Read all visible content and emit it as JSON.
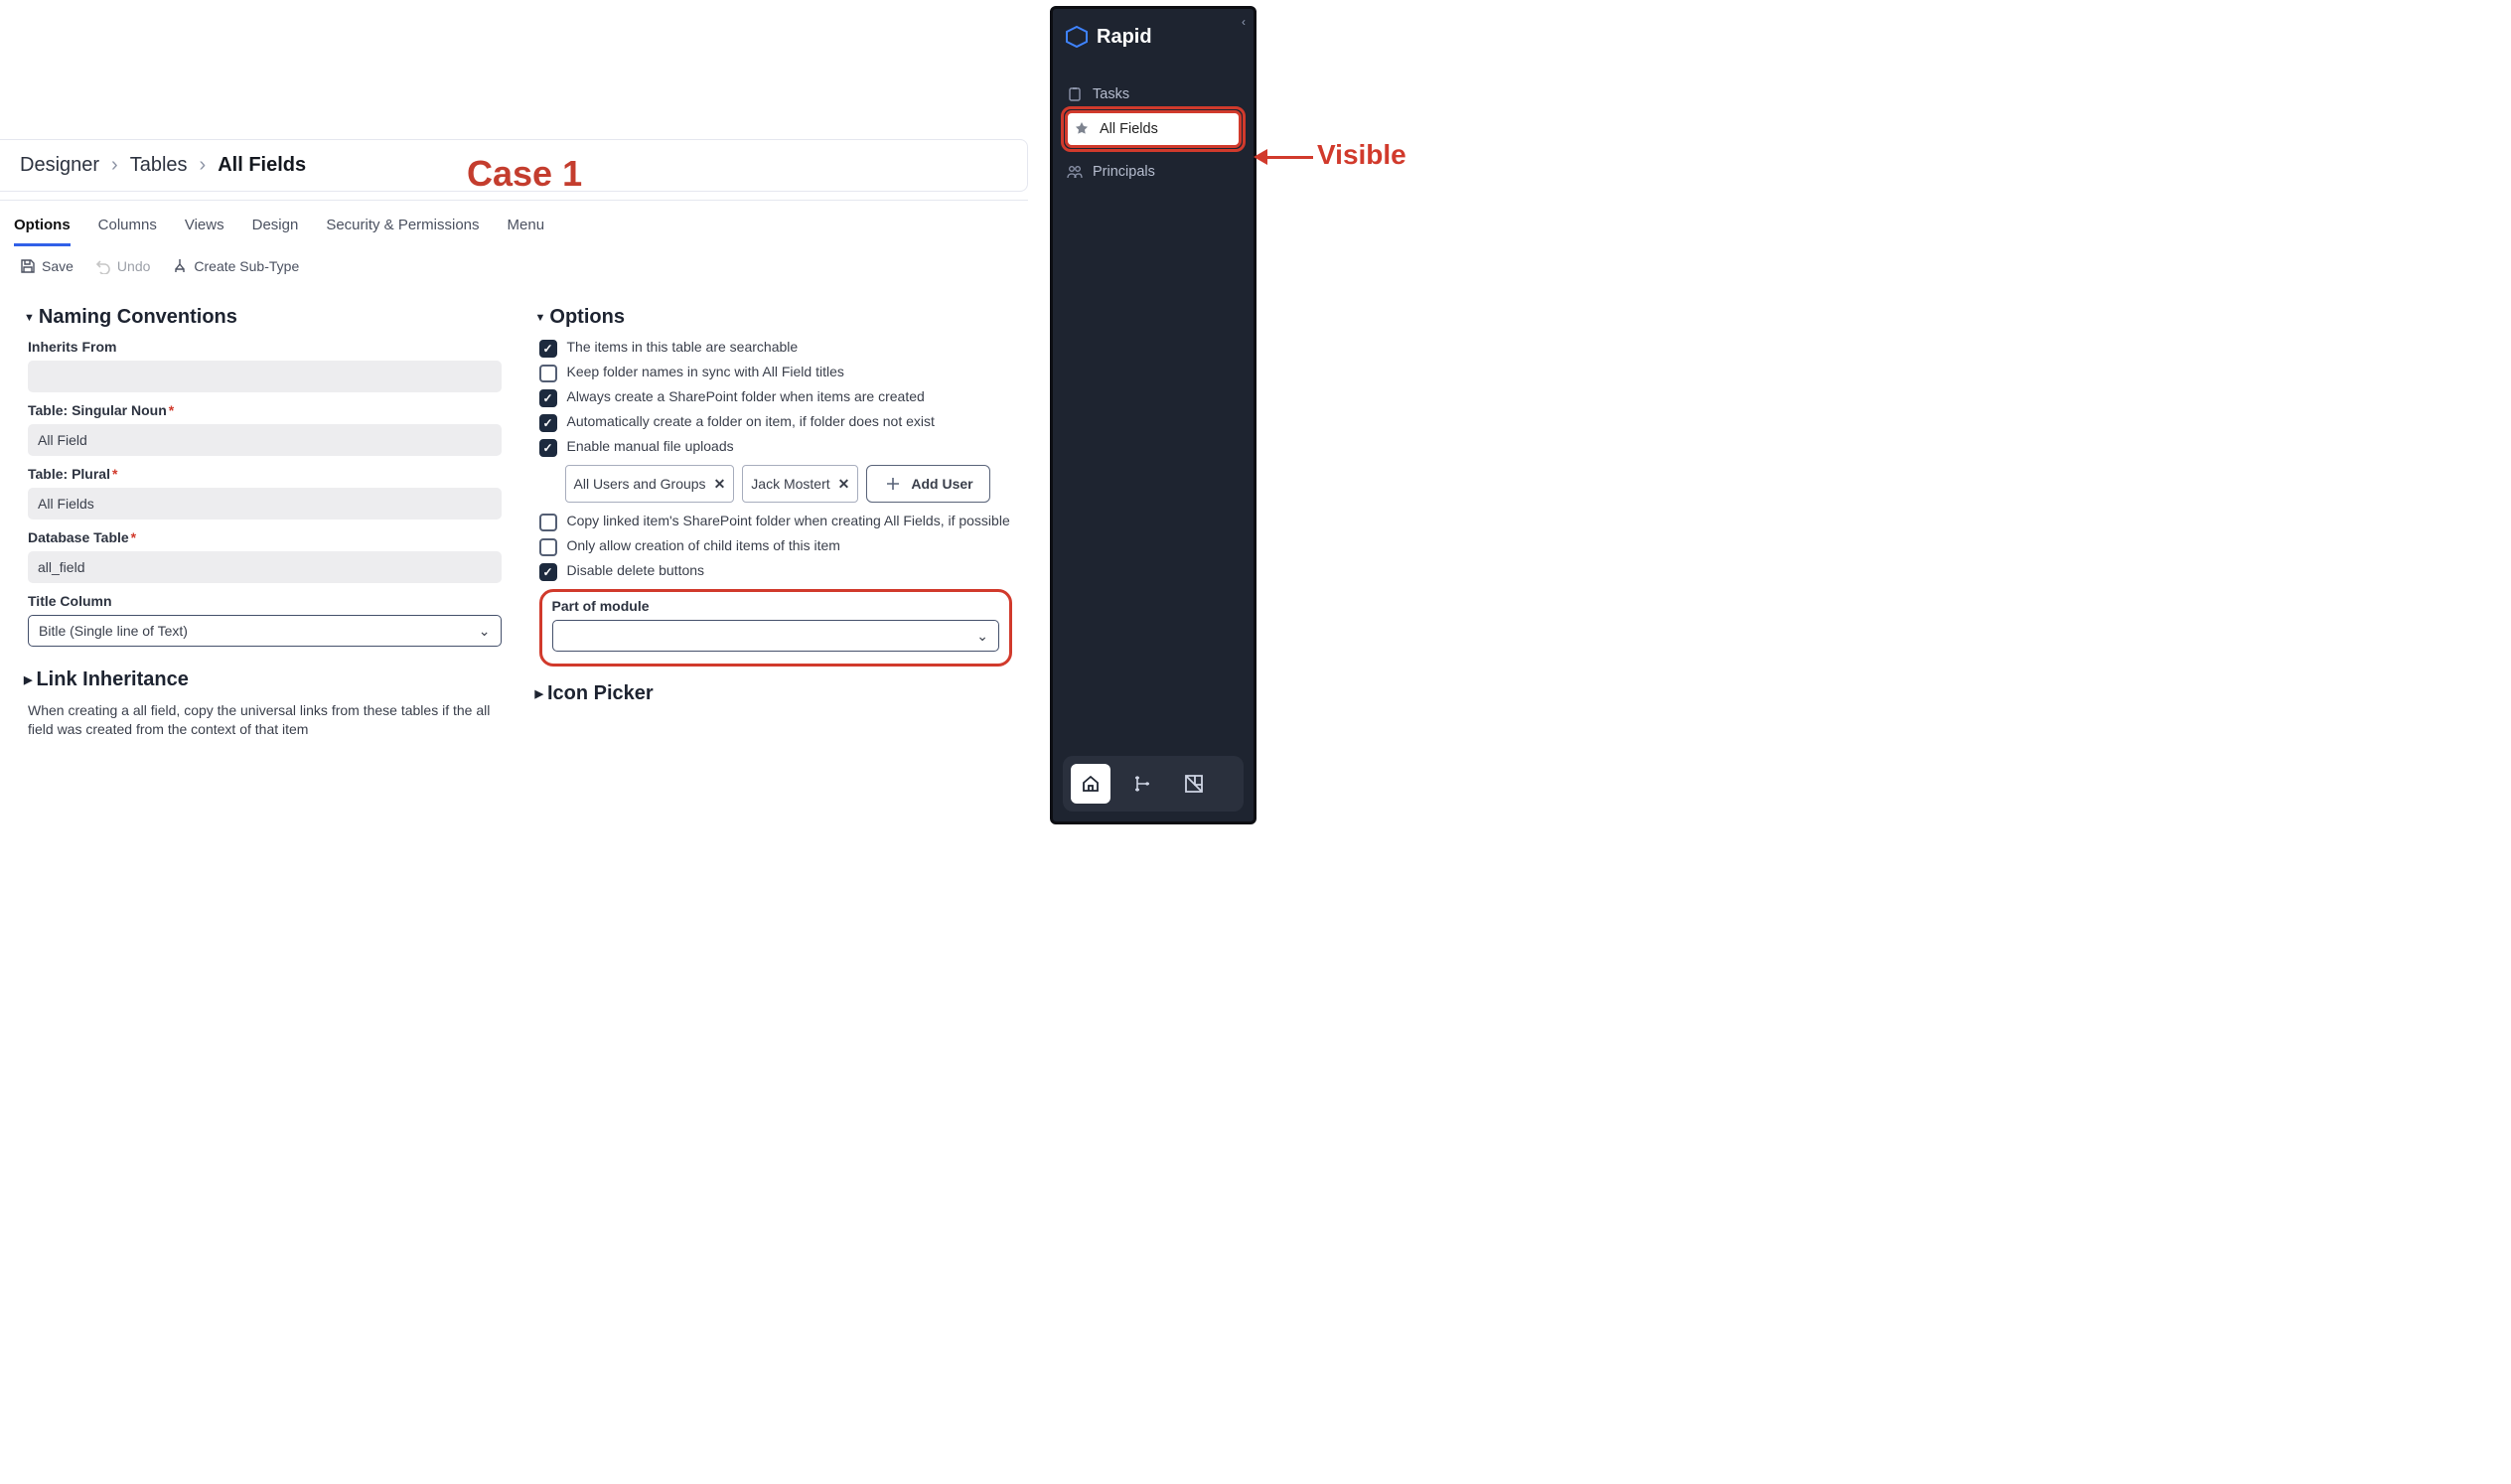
{
  "annotations": {
    "case_label": "Case 1",
    "visible_label": "Visible"
  },
  "breadcrumb": {
    "seg1": "Designer",
    "seg2": "Tables",
    "current": "All Fields"
  },
  "tabs": {
    "options": "Options",
    "columns": "Columns",
    "views": "Views",
    "design": "Design",
    "security": "Security & Permissions",
    "menu": "Menu"
  },
  "toolbar": {
    "save": "Save",
    "undo": "Undo",
    "create_sub": "Create Sub-Type"
  },
  "naming": {
    "heading": "Naming Conventions",
    "inherits_label": "Inherits From",
    "inherits_value": "",
    "singular_label": "Table: Singular Noun",
    "singular_value": "All Field",
    "plural_label": "Table: Plural",
    "plural_value": "All Fields",
    "db_label": "Database Table",
    "db_value": "all_field",
    "title_col_label": "Title Column",
    "title_col_value": "Bitle (Single line of Text)"
  },
  "link_inherit": {
    "heading": "Link Inheritance",
    "desc": "When creating a all field, copy the universal links from these tables if the all field was created from the context of that item"
  },
  "options": {
    "heading": "Options",
    "r1": "The items in this table are searchable",
    "r2": "Keep folder names in sync with All Field titles",
    "r3": "Always create a SharePoint folder when items are created",
    "r4": "Automatically create a folder on item, if folder does not exist",
    "r5": "Enable manual file uploads",
    "chip1": "All Users and Groups",
    "chip2": "Jack Mostert",
    "add_user": "Add User",
    "r6": "Copy linked item's SharePoint folder when creating All Fields, if possible",
    "r7": "Only allow creation of child items of this item",
    "r8": "Disable delete buttons",
    "module_label": "Part of module",
    "module_value": "",
    "icon_picker": "Icon Picker"
  },
  "sidebar": {
    "brand": "Rapid",
    "items": {
      "tasks": "Tasks",
      "all_fields": "All Fields",
      "principals": "Principals"
    }
  }
}
